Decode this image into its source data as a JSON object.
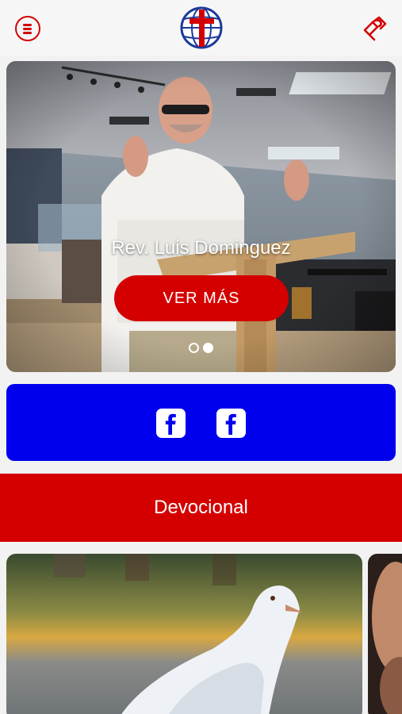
{
  "header": {
    "menu_icon": "hamburger-menu-icon",
    "logo_icon": "church-globe-cross-logo",
    "give_icon": "hand-heart-give-icon"
  },
  "hero": {
    "title": "Rev. Luis Dominguez",
    "button_label": "VER MÁS",
    "slides_total": 2,
    "active_slide": 2
  },
  "social": {
    "links": [
      {
        "icon": "facebook-icon"
      },
      {
        "icon": "facebook-icon"
      }
    ]
  },
  "devotional": {
    "title": "Devocional",
    "cards": [
      {
        "image": "white-dove-photo"
      },
      {
        "image": "person-photo"
      }
    ]
  },
  "colors": {
    "accent_red": "#d40000",
    "social_blue": "#0000ee",
    "header_bg": "#f6f6f6",
    "page_bg": "#f2f2f2"
  }
}
